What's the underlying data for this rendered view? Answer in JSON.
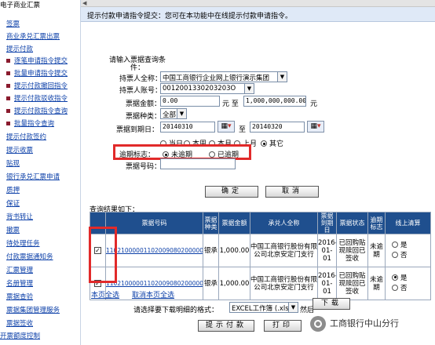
{
  "header": {
    "title": "提示付款申请指令提交：您可在本功能中在线提示付款申请指令。"
  },
  "sidebar": {
    "items": [
      {
        "label": "电子商业汇票",
        "type": "section"
      },
      {
        "label": "签票",
        "type": "link"
      },
      {
        "label": "商业承兑汇票出票",
        "type": "link"
      },
      {
        "label": "提示付款",
        "type": "link"
      },
      {
        "label": "逐笔申请指令提交",
        "type": "sub"
      },
      {
        "label": "批量申请指令提交",
        "type": "sub"
      },
      {
        "label": "提示付款撤回指令",
        "type": "sub"
      },
      {
        "label": "提示付款驳收指令",
        "type": "sub"
      },
      {
        "label": "提示付款指令查询",
        "type": "sub"
      },
      {
        "label": "批量指令查询",
        "type": "sub"
      },
      {
        "label": "提示付款签约",
        "type": "link"
      },
      {
        "label": "提示收票",
        "type": "link"
      },
      {
        "label": "贴现",
        "type": "link"
      },
      {
        "label": "银行承兑汇票申请",
        "type": "link"
      },
      {
        "label": "质押",
        "type": "link"
      },
      {
        "label": "保证",
        "type": "link"
      },
      {
        "label": "背书转让",
        "type": "link"
      },
      {
        "label": "撤票",
        "type": "link"
      },
      {
        "label": "待处理任务",
        "type": "link"
      },
      {
        "label": "付款票据通知务",
        "type": "link"
      },
      {
        "label": "汇票管理",
        "type": "link"
      },
      {
        "label": "名册管理",
        "type": "link"
      },
      {
        "label": "票据查验",
        "type": "link"
      },
      {
        "label": "票据集团管理服务",
        "type": "link"
      },
      {
        "label": "票据签收",
        "type": "link"
      },
      {
        "label": "开票额度控制",
        "type": "link"
      }
    ]
  },
  "form": {
    "condition_label": "请输入票据查询条件：",
    "holder_name_label": "持票人全称：",
    "holder_name_value": "中国工商银行企业网上银行演示集团",
    "holder_account_label": "持票人账号：",
    "holder_account_value": "0012001330203203O",
    "amount_label": "票据金额：",
    "amount_from": "0.00",
    "amount_to": "1,000,000,000.00",
    "unit": "元",
    "unit_to": "元 至",
    "bill_type_label": "票据种类：",
    "bill_type_value": "全部",
    "due_date_label": "票据到期日：",
    "due_from": "20140310",
    "due_to": "20140320",
    "to": "至",
    "quick_dates": [
      "当日",
      "本周",
      "本月",
      "上月",
      "其它"
    ],
    "overdue_label": "逾期标志：",
    "overdue_options": [
      "未逾期",
      "已逾期"
    ],
    "bill_no_label": "票据号码：",
    "confirm_button": "确定",
    "cancel_button": "取消"
  },
  "results": {
    "title": "查询结果如下：",
    "columns": [
      "",
      "票据号码",
      "票据种类",
      "票据金额",
      "承兑人全称",
      "票据到期日",
      "票据状态",
      "逾期标志",
      "线上清算"
    ],
    "rows": [
      {
        "checked": true,
        "bill_no": "1102100000110200908020000077…",
        "type": "银承",
        "amount": "1,000.00",
        "acceptor": "中国工商银行股份有限公司北京安定门支行",
        "due": "2016-01-01",
        "status": "已回购贴现赎回已签收",
        "overdue": "未逾期",
        "online_yes": "是",
        "online_no": "否",
        "online_selected": "none"
      },
      {
        "checked": true,
        "bill_no": "1102100000110200908020000077…",
        "type": "银承",
        "amount": "1,000.00",
        "acceptor": "中国工商银行股份有限公司北京安定门支行",
        "due": "2016-01-01",
        "status": "已回购贴现赎回已签收",
        "overdue": "未逾期",
        "online_yes": "是",
        "online_no": "否",
        "online_selected": "yes"
      }
    ]
  },
  "bottom": {
    "select_page": "本页全选",
    "unselect_page": "取消本页全选",
    "download_label": "请选择要下载明细的格式：",
    "format_value": "EXCEL工作簿 (.xls)",
    "then": "然后",
    "download_button": "下载",
    "submit_button": "提示付款",
    "print_button": "打印"
  },
  "watermark": "工商银行中山分行",
  "colors": {
    "highlight": "#e12a2a",
    "table_header": "#1f4f8e",
    "link": "#0b3fa8",
    "title_bar": "#dfe9f7"
  }
}
